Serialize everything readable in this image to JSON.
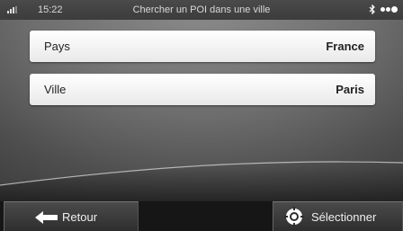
{
  "status": {
    "time": "15:22",
    "title": "Chercher un POI dans une ville",
    "icons": [
      "signal-icon",
      "bluetooth-icon",
      "gps-dots-icon"
    ]
  },
  "rows": [
    {
      "label": "Pays",
      "value": "France"
    },
    {
      "label": "Ville",
      "value": "Paris"
    }
  ],
  "buttons": {
    "back_label": "Retour",
    "select_label": "Sélectionner"
  },
  "colors": {
    "background": "#6e6e6e",
    "row": "#f4f4f4",
    "bottom_bar": "#161616"
  }
}
